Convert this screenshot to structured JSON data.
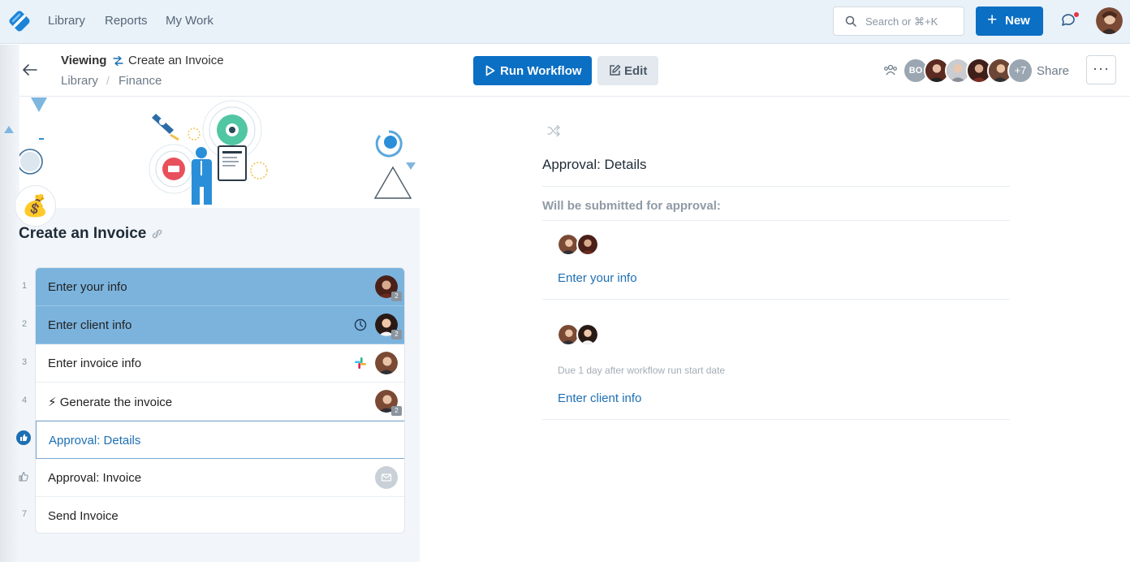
{
  "nav": {
    "links": [
      "Library",
      "Reports",
      "My Work"
    ]
  },
  "search": {
    "placeholder": "Search or ⌘+K"
  },
  "new_button": "New",
  "header": {
    "viewing_label": "Viewing",
    "workflow_name": "Create an Invoice",
    "breadcrumb": [
      "Library",
      "Finance"
    ],
    "breadcrumb_sep": "/",
    "run_label": "Run Workflow",
    "edit_label": "Edit",
    "collaborator_initials": "BO",
    "more_count": "+7",
    "share_label": "Share"
  },
  "workflow": {
    "icon": "money-bag-icon",
    "title": "Create an Invoice",
    "steps": [
      {
        "num": "1",
        "label": "Enter your info",
        "state": "done",
        "badge": "2"
      },
      {
        "num": "2",
        "label": "Enter client info",
        "state": "done",
        "badge": "2"
      },
      {
        "num": "3",
        "label": "Enter invoice info",
        "state": "pending"
      },
      {
        "num": "4",
        "label": "⚡ Generate the invoice",
        "state": "pending",
        "badge": "2"
      },
      {
        "num": "",
        "label": "Approval: Details",
        "state": "active"
      },
      {
        "num": "",
        "label": "Approval: Invoice",
        "state": "pending"
      },
      {
        "num": "7",
        "label": "Send Invoice",
        "state": "pending"
      }
    ]
  },
  "detail": {
    "title": "Approval: Details",
    "submitted_label": "Will be submitted for approval:",
    "items": [
      {
        "link": "Enter your info"
      },
      {
        "due": "Due 1 day after workflow run start date",
        "link": "Enter client info"
      }
    ]
  },
  "colors": {
    "primary": "#0b6fc4",
    "done_step": "#7bb3dd",
    "link": "#1d6fb3"
  }
}
